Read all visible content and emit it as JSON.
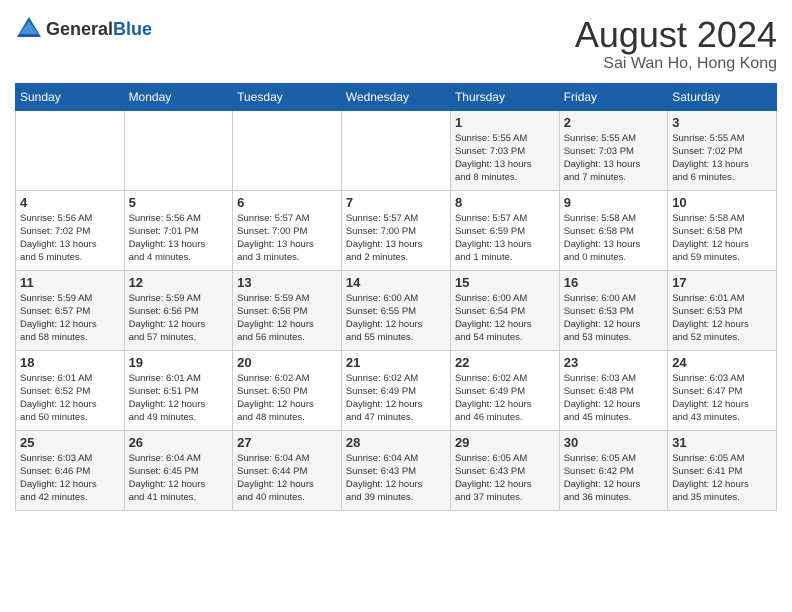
{
  "header": {
    "logo_general": "General",
    "logo_blue": "Blue",
    "month_year": "August 2024",
    "location": "Sai Wan Ho, Hong Kong"
  },
  "weekdays": [
    "Sunday",
    "Monday",
    "Tuesday",
    "Wednesday",
    "Thursday",
    "Friday",
    "Saturday"
  ],
  "weeks": [
    [
      {
        "day": "",
        "info": ""
      },
      {
        "day": "",
        "info": ""
      },
      {
        "day": "",
        "info": ""
      },
      {
        "day": "",
        "info": ""
      },
      {
        "day": "1",
        "info": "Sunrise: 5:55 AM\nSunset: 7:03 PM\nDaylight: 13 hours\nand 8 minutes."
      },
      {
        "day": "2",
        "info": "Sunrise: 5:55 AM\nSunset: 7:03 PM\nDaylight: 13 hours\nand 7 minutes."
      },
      {
        "day": "3",
        "info": "Sunrise: 5:55 AM\nSunset: 7:02 PM\nDaylight: 13 hours\nand 6 minutes."
      }
    ],
    [
      {
        "day": "4",
        "info": "Sunrise: 5:56 AM\nSunset: 7:02 PM\nDaylight: 13 hours\nand 5 minutes."
      },
      {
        "day": "5",
        "info": "Sunrise: 5:56 AM\nSunset: 7:01 PM\nDaylight: 13 hours\nand 4 minutes."
      },
      {
        "day": "6",
        "info": "Sunrise: 5:57 AM\nSunset: 7:00 PM\nDaylight: 13 hours\nand 3 minutes."
      },
      {
        "day": "7",
        "info": "Sunrise: 5:57 AM\nSunset: 7:00 PM\nDaylight: 13 hours\nand 2 minutes."
      },
      {
        "day": "8",
        "info": "Sunrise: 5:57 AM\nSunset: 6:59 PM\nDaylight: 13 hours\nand 1 minute."
      },
      {
        "day": "9",
        "info": "Sunrise: 5:58 AM\nSunset: 6:58 PM\nDaylight: 13 hours\nand 0 minutes."
      },
      {
        "day": "10",
        "info": "Sunrise: 5:58 AM\nSunset: 6:58 PM\nDaylight: 12 hours\nand 59 minutes."
      }
    ],
    [
      {
        "day": "11",
        "info": "Sunrise: 5:59 AM\nSunset: 6:57 PM\nDaylight: 12 hours\nand 58 minutes."
      },
      {
        "day": "12",
        "info": "Sunrise: 5:59 AM\nSunset: 6:56 PM\nDaylight: 12 hours\nand 57 minutes."
      },
      {
        "day": "13",
        "info": "Sunrise: 5:59 AM\nSunset: 6:56 PM\nDaylight: 12 hours\nand 56 minutes."
      },
      {
        "day": "14",
        "info": "Sunrise: 6:00 AM\nSunset: 6:55 PM\nDaylight: 12 hours\nand 55 minutes."
      },
      {
        "day": "15",
        "info": "Sunrise: 6:00 AM\nSunset: 6:54 PM\nDaylight: 12 hours\nand 54 minutes."
      },
      {
        "day": "16",
        "info": "Sunrise: 6:00 AM\nSunset: 6:53 PM\nDaylight: 12 hours\nand 53 minutes."
      },
      {
        "day": "17",
        "info": "Sunrise: 6:01 AM\nSunset: 6:53 PM\nDaylight: 12 hours\nand 52 minutes."
      }
    ],
    [
      {
        "day": "18",
        "info": "Sunrise: 6:01 AM\nSunset: 6:52 PM\nDaylight: 12 hours\nand 50 minutes."
      },
      {
        "day": "19",
        "info": "Sunrise: 6:01 AM\nSunset: 6:51 PM\nDaylight: 12 hours\nand 49 minutes."
      },
      {
        "day": "20",
        "info": "Sunrise: 6:02 AM\nSunset: 6:50 PM\nDaylight: 12 hours\nand 48 minutes."
      },
      {
        "day": "21",
        "info": "Sunrise: 6:02 AM\nSunset: 6:49 PM\nDaylight: 12 hours\nand 47 minutes."
      },
      {
        "day": "22",
        "info": "Sunrise: 6:02 AM\nSunset: 6:49 PM\nDaylight: 12 hours\nand 46 minutes."
      },
      {
        "day": "23",
        "info": "Sunrise: 6:03 AM\nSunset: 6:48 PM\nDaylight: 12 hours\nand 45 minutes."
      },
      {
        "day": "24",
        "info": "Sunrise: 6:03 AM\nSunset: 6:47 PM\nDaylight: 12 hours\nand 43 minutes."
      }
    ],
    [
      {
        "day": "25",
        "info": "Sunrise: 6:03 AM\nSunset: 6:46 PM\nDaylight: 12 hours\nand 42 minutes."
      },
      {
        "day": "26",
        "info": "Sunrise: 6:04 AM\nSunset: 6:45 PM\nDaylight: 12 hours\nand 41 minutes."
      },
      {
        "day": "27",
        "info": "Sunrise: 6:04 AM\nSunset: 6:44 PM\nDaylight: 12 hours\nand 40 minutes."
      },
      {
        "day": "28",
        "info": "Sunrise: 6:04 AM\nSunset: 6:43 PM\nDaylight: 12 hours\nand 39 minutes."
      },
      {
        "day": "29",
        "info": "Sunrise: 6:05 AM\nSunset: 6:43 PM\nDaylight: 12 hours\nand 37 minutes."
      },
      {
        "day": "30",
        "info": "Sunrise: 6:05 AM\nSunset: 6:42 PM\nDaylight: 12 hours\nand 36 minutes."
      },
      {
        "day": "31",
        "info": "Sunrise: 6:05 AM\nSunset: 6:41 PM\nDaylight: 12 hours\nand 35 minutes."
      }
    ]
  ]
}
